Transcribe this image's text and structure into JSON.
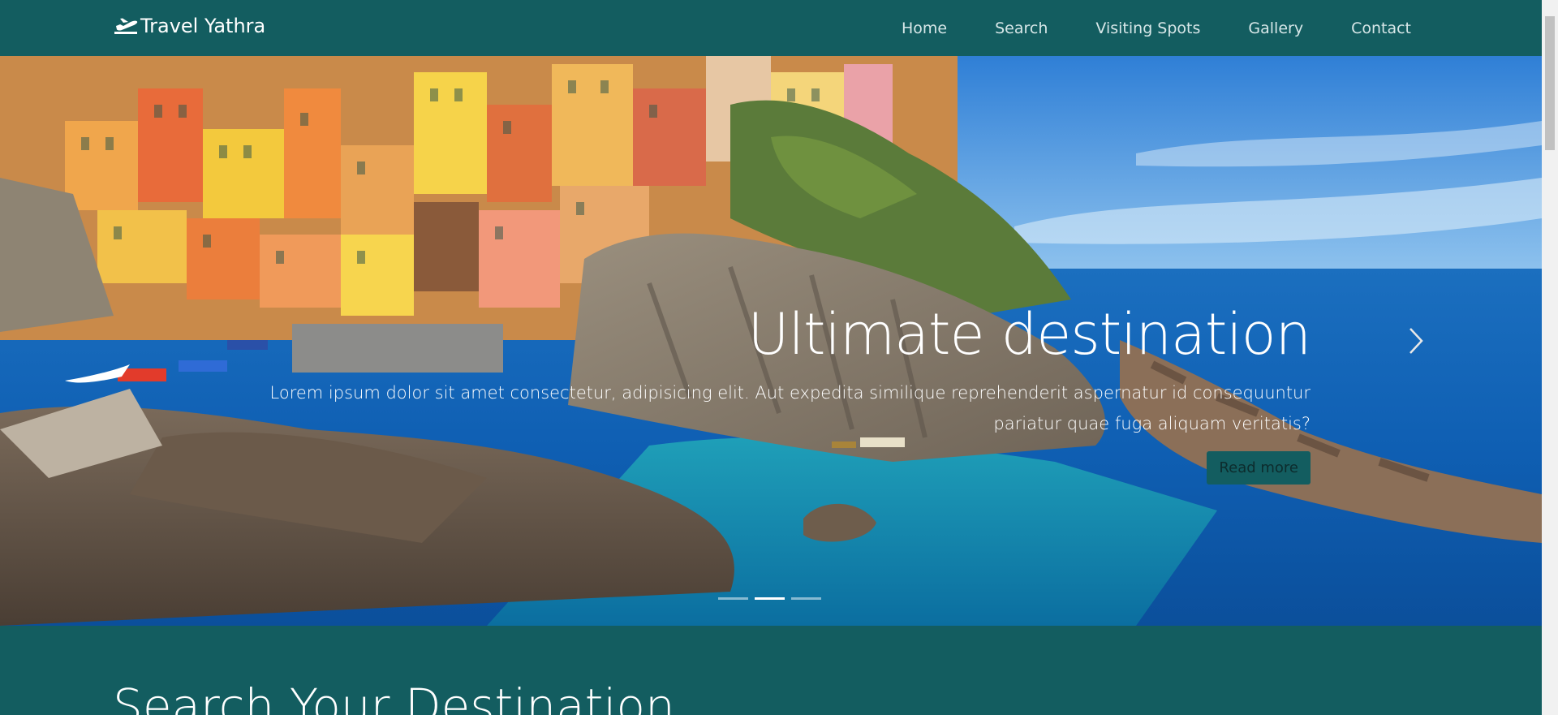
{
  "brand": {
    "name": "Travel Yathra",
    "icon": "plane-icon"
  },
  "nav": {
    "items": [
      {
        "label": "Home"
      },
      {
        "label": "Search"
      },
      {
        "label": "Visiting Spots"
      },
      {
        "label": "Gallery"
      },
      {
        "label": "Contact"
      }
    ]
  },
  "hero": {
    "title": "Ultimate destination",
    "text_line1": "Lorem ipsum dolor sit amet consectetur, adipisicing elit. Aut expedita similique reprehenderit aspernatur id consequuntur",
    "text_line2": "pariatur quae fuga aliquam veritatis?",
    "button_label": "Read more",
    "next_icon": "chevron-right-icon",
    "slides": 3,
    "active_slide": 2
  },
  "search_section": {
    "title": "Search Your Destination"
  },
  "colors": {
    "primary": "#135d60",
    "text": "#ffffff"
  }
}
